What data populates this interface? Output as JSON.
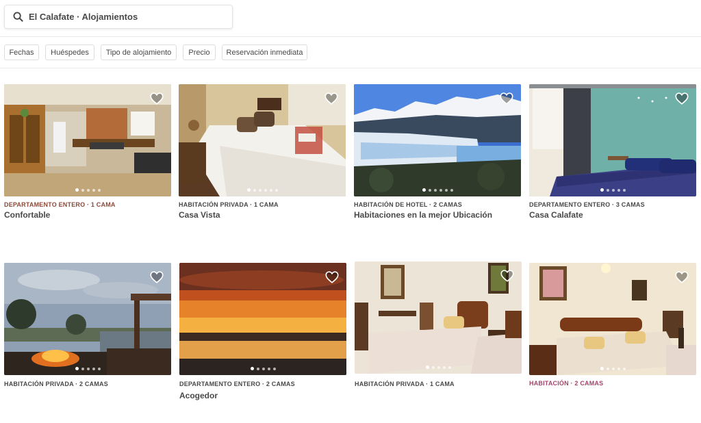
{
  "search": {
    "label": "El Calafate · Alojamientos"
  },
  "filters": [
    "Fechas",
    "Huéspedes",
    "Tipo de alojamiento",
    "Precio",
    "Reservación inmediata"
  ],
  "colors": {
    "type_entire": "#8a4a3a",
    "type_room": "#484848",
    "type_red": "#a3456a"
  },
  "listings": [
    {
      "type": "DEPARTAMENTO ENTERO · 1 CAMA",
      "title": "Confortable",
      "type_color": "#8a4a3a"
    },
    {
      "type": "HABITACIÓN PRIVADA · 1 CAMA",
      "title": "Casa Vista",
      "type_color": "#484848"
    },
    {
      "type": "HABITACIÓN DE HOTEL · 2 CAMAS",
      "title": "Habitaciones en la mejor Ubicación",
      "type_color": "#484848"
    },
    {
      "type": "DEPARTAMENTO ENTERO · 3 CAMAS",
      "title": "Casa Calafate",
      "type_color": "#484848"
    },
    {
      "type": "HABITACIÓN PRIVADA · 2 CAMAS",
      "title": "",
      "type_color": "#484848"
    },
    {
      "type": "DEPARTAMENTO ENTERO · 2 CAMAS",
      "title": "Acogedor",
      "type_color": "#484848"
    },
    {
      "type": "HABITACIÓN PRIVADA · 1 CAMA",
      "title": "",
      "type_color": "#484848"
    },
    {
      "type": "HABITACIÓN · 2 CAMAS",
      "title": "",
      "type_color": "#a3456a"
    }
  ]
}
